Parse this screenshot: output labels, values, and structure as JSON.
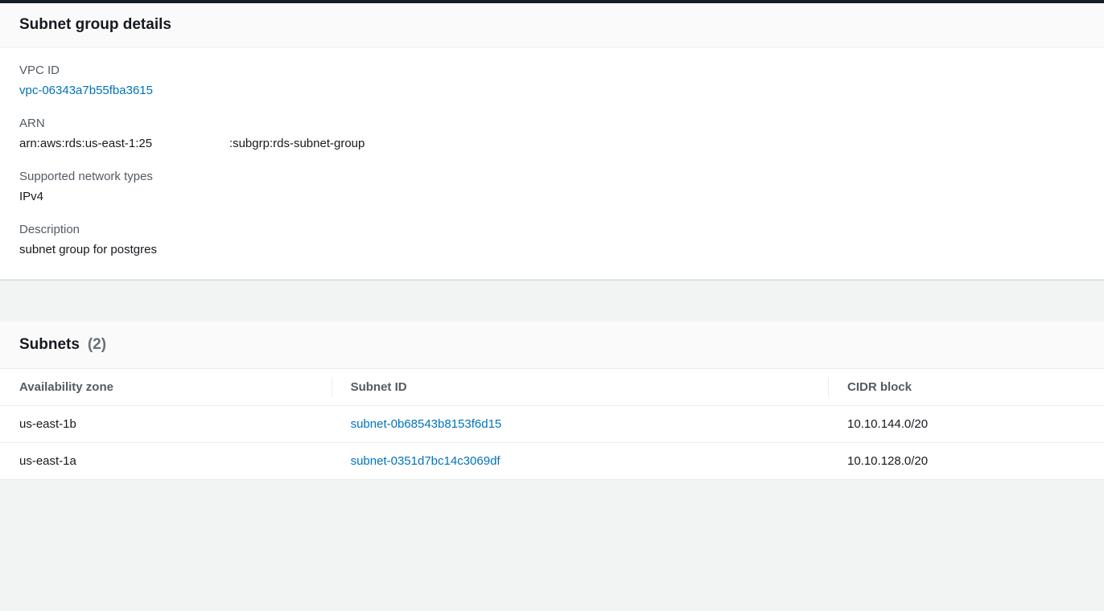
{
  "details": {
    "title": "Subnet group details",
    "vpc_id_label": "VPC ID",
    "vpc_id": "vpc-06343a7b55fba3615",
    "arn_label": "ARN",
    "arn": "arn:aws:rds:us-east-1:25                       :subgrp:rds-subnet-group",
    "network_types_label": "Supported network types",
    "network_types": "IPv4",
    "description_label": "Description",
    "description": "subnet group for postgres"
  },
  "subnets": {
    "title": "Subnets",
    "count": "(2)",
    "columns": {
      "az": "Availability zone",
      "subnet_id": "Subnet ID",
      "cidr": "CIDR block"
    },
    "rows": [
      {
        "az": "us-east-1b",
        "subnet_id": "subnet-0b68543b8153f6d15",
        "cidr": "10.10.144.0/20"
      },
      {
        "az": "us-east-1a",
        "subnet_id": "subnet-0351d7bc14c3069df",
        "cidr": "10.10.128.0/20"
      }
    ]
  }
}
